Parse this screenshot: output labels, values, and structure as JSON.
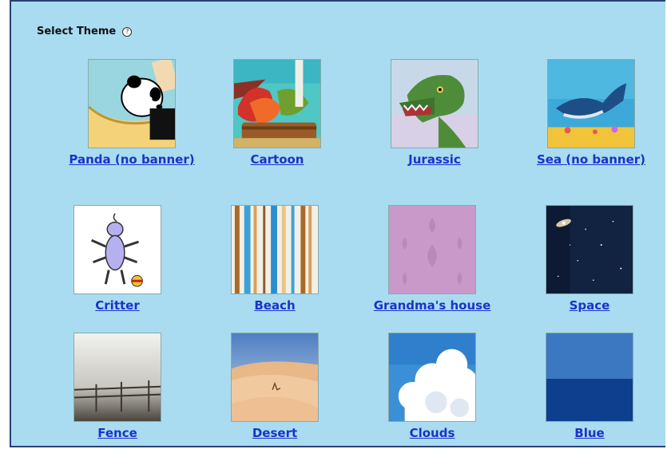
{
  "header": {
    "title": "Select Theme",
    "help_icon": "question-circle-icon"
  },
  "themes": [
    {
      "label": "Panda (no banner)",
      "icon": "panda-image"
    },
    {
      "label": "Cartoon",
      "icon": "cartoon-image"
    },
    {
      "label": "Jurassic",
      "icon": "dinosaur-image"
    },
    {
      "label": "Sea (no banner)",
      "icon": "whale-image"
    },
    {
      "label": "Critter",
      "icon": "critter-image"
    },
    {
      "label": "Beach",
      "icon": "beach-stripes-image"
    },
    {
      "label": "Grandma's house",
      "icon": "wallpaper-image"
    },
    {
      "label": "Space",
      "icon": "galaxy-image"
    },
    {
      "label": "Fence",
      "icon": "fence-image"
    },
    {
      "label": "Desert",
      "icon": "desert-image"
    },
    {
      "label": "Clouds",
      "icon": "clouds-image"
    },
    {
      "label": "Blue",
      "icon": "blue-image"
    }
  ],
  "colors": {
    "panel_bg": "#a9dcf1",
    "link": "#1a33c9",
    "border": "#2a3f72"
  }
}
